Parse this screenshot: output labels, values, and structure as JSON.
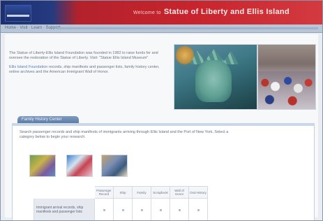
{
  "banner": {
    "prefix": "Welcome to",
    "title": "Statue of Liberty and Ellis Island"
  },
  "nav": {
    "text": "Home  ·  Visit  ·  Learn  ·  Support"
  },
  "intro": {
    "paragraph1": "The Statue of Liberty-Ellis Island Foundation was founded in 1982 to raise funds for and oversee the restoration of the Statue of Liberty. Visit: \"Statue Ellis Island Museum\"",
    "link_text": "Ellis Island Foundation",
    "paragraph2": "records, ship manifests and passenger lists, family history center, online archives and the American Immigrant Wall of Honor."
  },
  "section": {
    "tab_label": "Family History Center",
    "description": "Search passenger records and ship manifests of immigrants arriving through Ellis Island and the Port of New York. Select a category below to begin your research."
  },
  "table": {
    "headers": [
      "Passenger Record",
      "Ship",
      "Family",
      "Scrapbook",
      "Wall of Honor",
      "Oral History"
    ],
    "row_label": "Immigrant arrival records, ship manifests and passenger lists"
  },
  "colors": {
    "banner_blue": "#1d2f6e",
    "banner_red": "#c8242d",
    "tab": "#5d7ca6"
  }
}
